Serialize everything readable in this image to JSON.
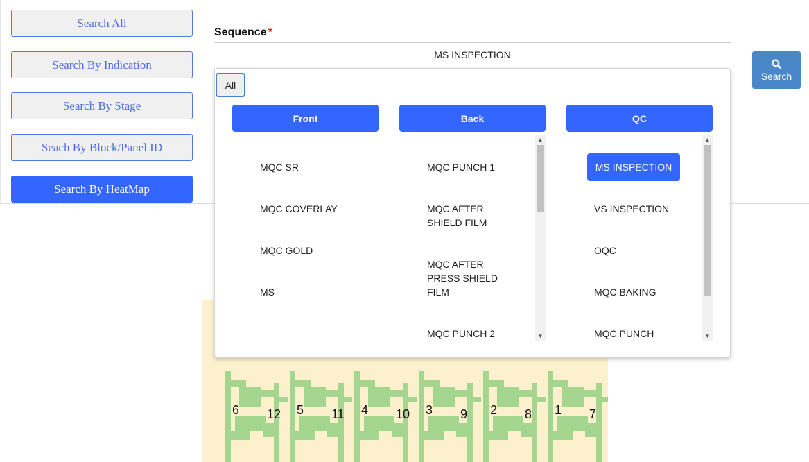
{
  "sidebar": {
    "items": [
      {
        "label": "Search All",
        "active": false
      },
      {
        "label": "Search By Indication",
        "active": false
      },
      {
        "label": "Search By Stage",
        "active": false
      },
      {
        "label": "Seach By Block/Panel ID",
        "active": false
      },
      {
        "label": "Search By HeatMap",
        "active": true
      }
    ]
  },
  "form": {
    "sequence_label": "Sequence",
    "required_mark": "*",
    "sequence_value": "MS INSPECTION",
    "search_label": "Search",
    "search_icon": "search-icon"
  },
  "dropdown": {
    "all_label": "All",
    "columns": [
      {
        "header": "Front",
        "items": [
          "MQC SR",
          "MQC COVERLAY",
          "MQC GOLD",
          "MS"
        ]
      },
      {
        "header": "Back",
        "items": [
          "MQC PUNCH 1",
          "MQC AFTER SHIELD FILM",
          "MQC AFTER PRESS SHIELD FILM",
          "MQC PUNCH 2"
        ]
      },
      {
        "header": "QC",
        "items": [
          "MS INSPECTION",
          "VS INSPECTION",
          "OQC",
          "MQC BAKING",
          "MQC PUNCH"
        ],
        "selected": "MS INSPECTION"
      }
    ]
  },
  "heatmap": {
    "labels": [
      "6",
      "12",
      "5",
      "11",
      "4",
      "10",
      "3",
      "9",
      "2",
      "8",
      "1",
      "7"
    ],
    "colors": {
      "background": "#fdf0cd",
      "part": "#a4d68f"
    }
  },
  "colors": {
    "accent": "#3366ff",
    "search_button": "#4a87c9",
    "required": "#e02020"
  }
}
